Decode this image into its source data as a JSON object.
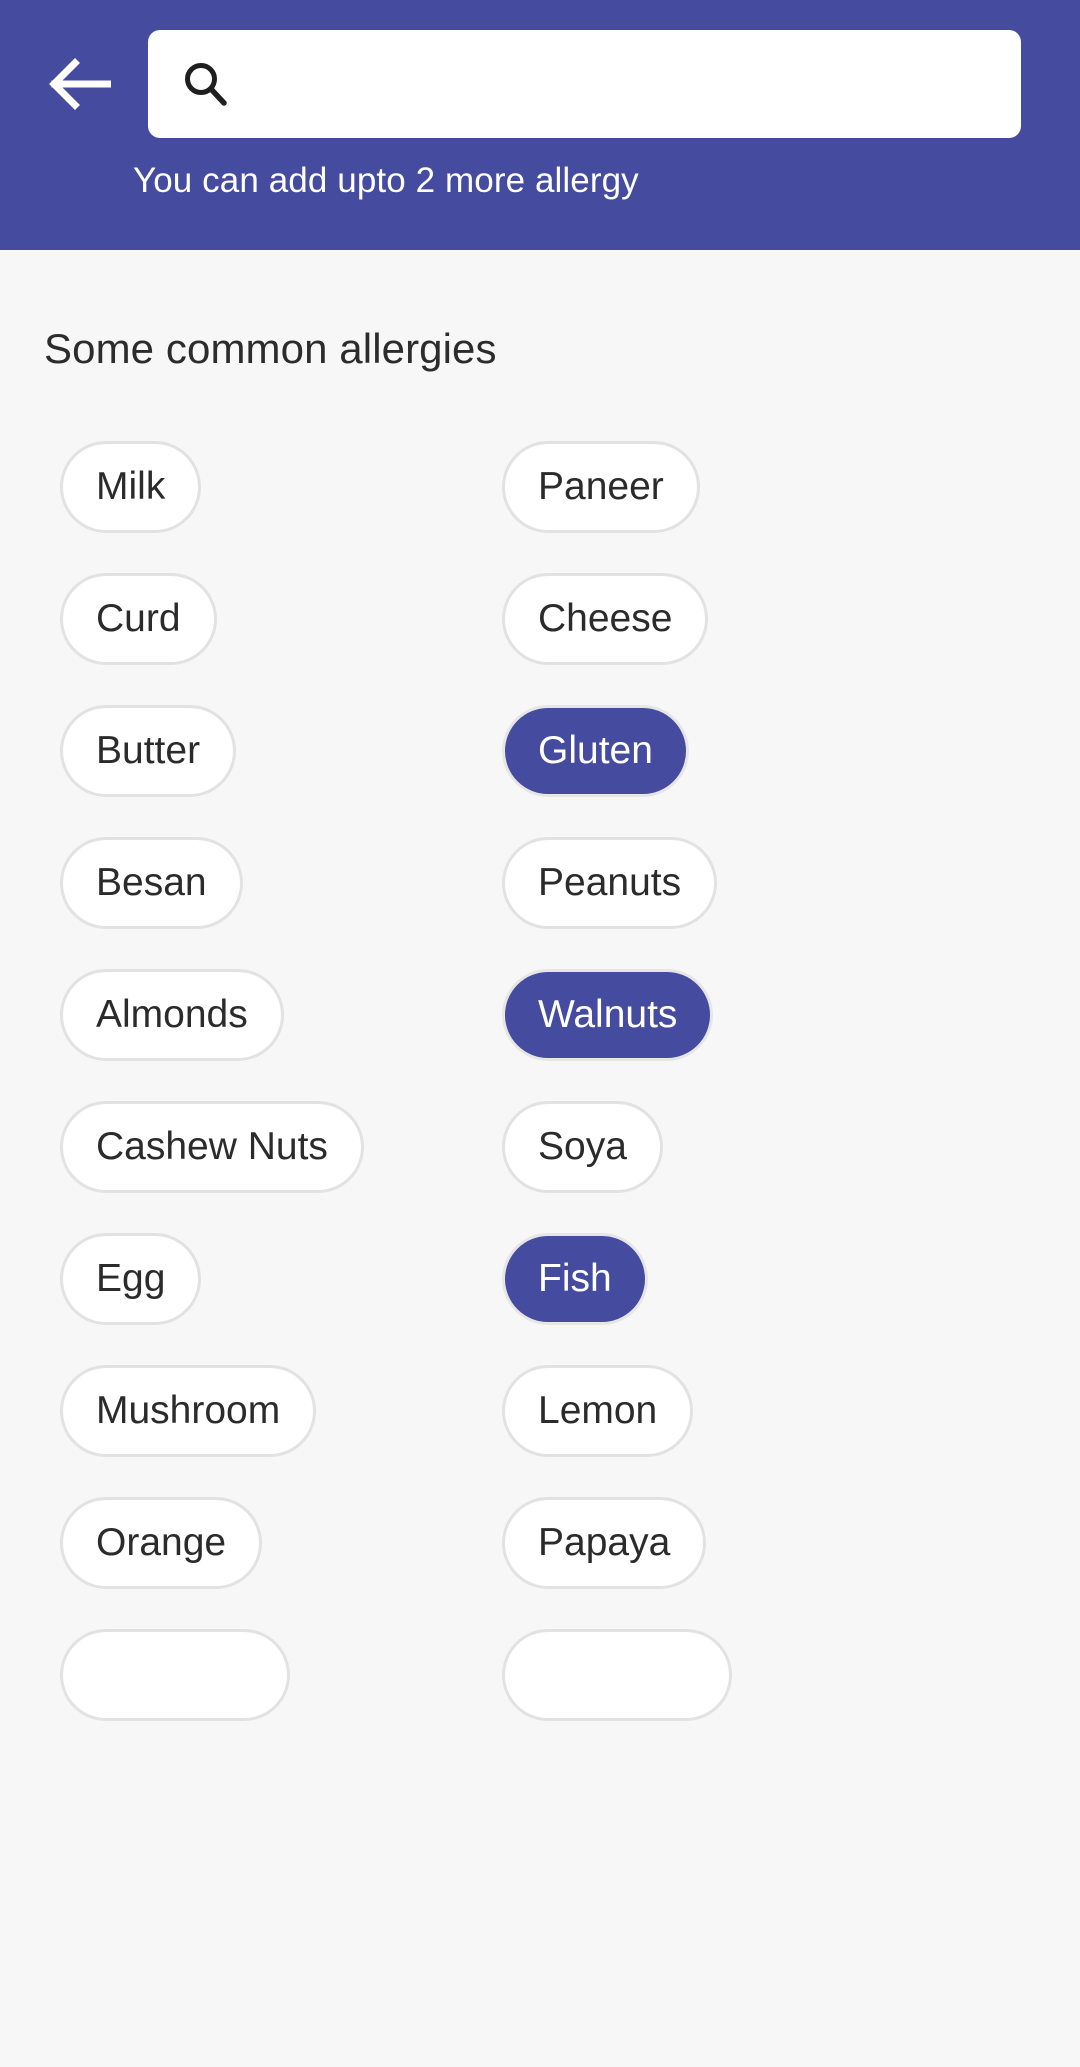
{
  "header": {
    "back_icon": "back-arrow-icon",
    "search_icon": "search-icon",
    "search_value": "",
    "search_placeholder": "",
    "hint_text": "You can add upto 2 more allergy",
    "background_color": "#454b9e",
    "text_color": "#ffffff"
  },
  "main": {
    "section_title": "Some common allergies",
    "background_color": "#f7f7f7",
    "chip_selected_color": "#454b9e",
    "chip_unselected_color": "#ffffff",
    "chip_border_color": "#e2e2e2",
    "rows": [
      {
        "left": {
          "label": "Milk",
          "selected": false
        },
        "right": {
          "label": "Paneer",
          "selected": false
        }
      },
      {
        "left": {
          "label": "Curd",
          "selected": false
        },
        "right": {
          "label": "Cheese",
          "selected": false
        }
      },
      {
        "left": {
          "label": "Butter",
          "selected": false
        },
        "right": {
          "label": "Gluten",
          "selected": true
        }
      },
      {
        "left": {
          "label": "Besan",
          "selected": false
        },
        "right": {
          "label": "Peanuts",
          "selected": false
        }
      },
      {
        "left": {
          "label": "Almonds",
          "selected": false
        },
        "right": {
          "label": "Walnuts",
          "selected": true
        }
      },
      {
        "left": {
          "label": "Cashew Nuts",
          "selected": false
        },
        "right": {
          "label": "Soya",
          "selected": false
        }
      },
      {
        "left": {
          "label": "Egg",
          "selected": false
        },
        "right": {
          "label": "Fish",
          "selected": true
        }
      },
      {
        "left": {
          "label": "Mushroom",
          "selected": false
        },
        "right": {
          "label": "Lemon",
          "selected": false
        }
      },
      {
        "left": {
          "label": "Orange",
          "selected": false
        },
        "right": {
          "label": "Papaya",
          "selected": false
        }
      },
      {
        "left": {
          "label": "",
          "selected": false
        },
        "right": {
          "label": "",
          "selected": false
        }
      }
    ]
  }
}
